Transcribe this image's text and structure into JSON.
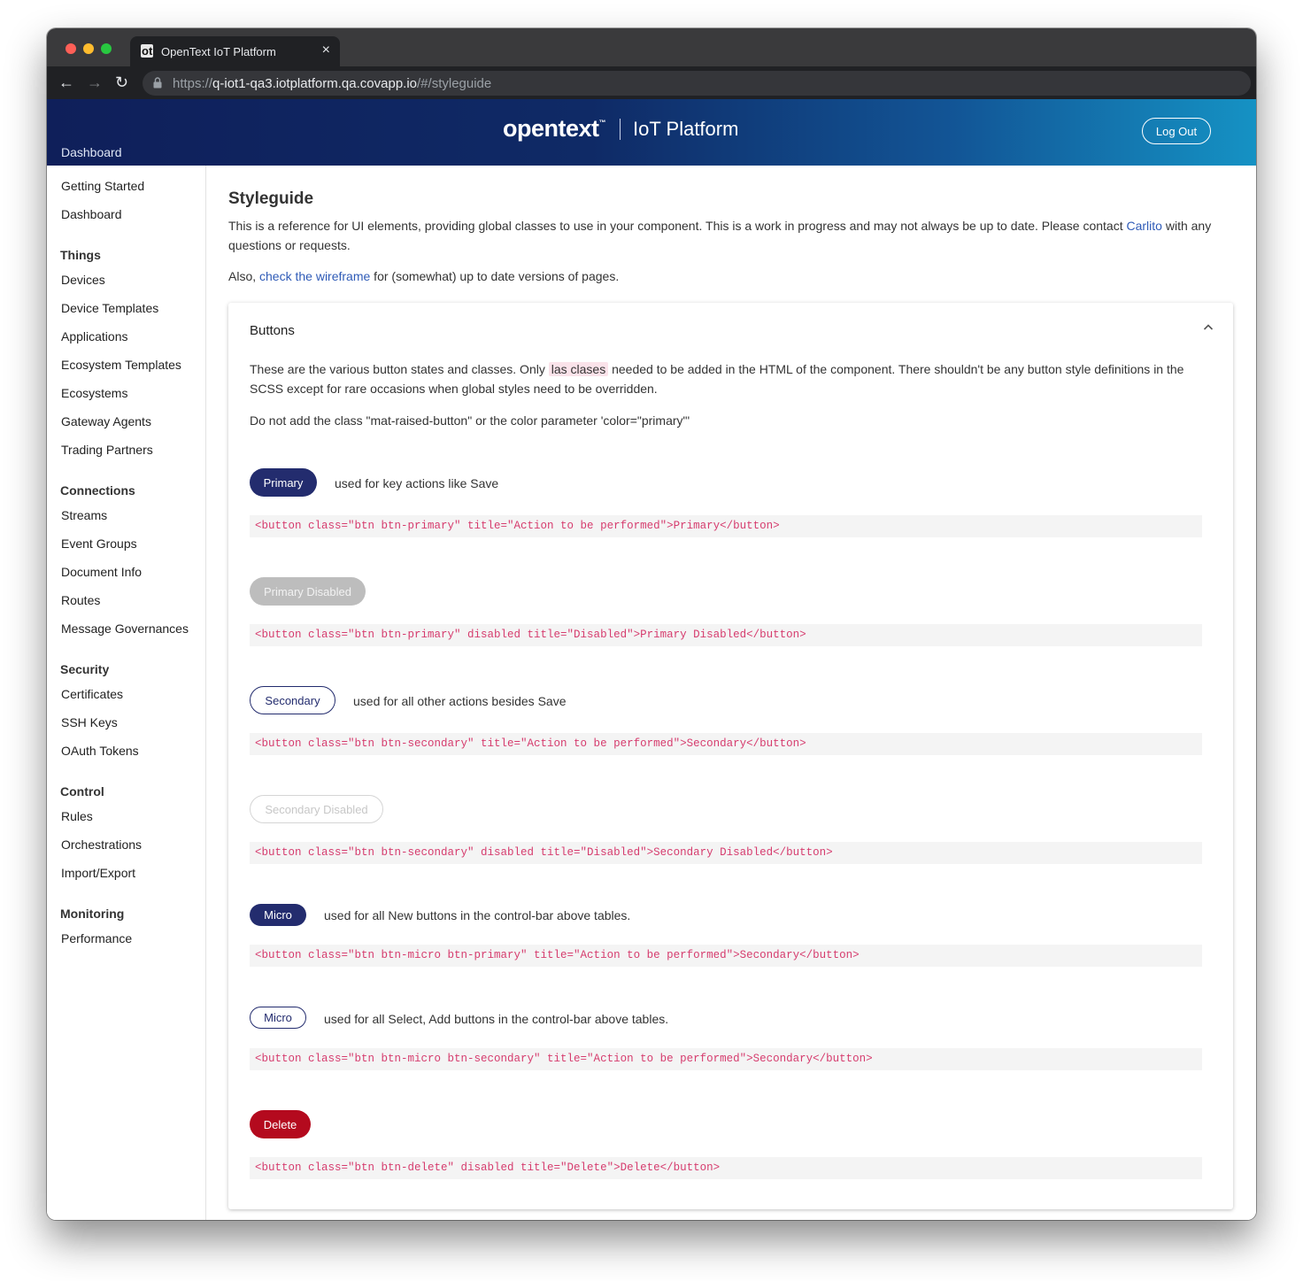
{
  "browser": {
    "tab_title": "OpenText IoT Platform",
    "tab_favicon": "ot",
    "close_icon": "×",
    "back_icon": "←",
    "forward_icon": "→",
    "reload_icon": "↻",
    "url_scheme": "https://",
    "url_host": "q-iot1-qa3.iotplatform.qa.covapp.io",
    "url_path": "/#/styleguide"
  },
  "header": {
    "breadcrumb": "Dashboard",
    "brand_logo": "opentext",
    "brand_tm": "™",
    "product_name": "IoT Platform",
    "logout_label": "Log Out",
    "gradient_colors": [
      "#0f1f5a",
      "#1592c4"
    ]
  },
  "sidebar": {
    "top_items": [
      "Getting Started",
      "Dashboard"
    ],
    "sections": [
      {
        "title": "Things",
        "items": [
          "Devices",
          "Device Templates",
          "Applications",
          "Ecosystem Templates",
          "Ecosystems",
          "Gateway Agents",
          "Trading Partners"
        ]
      },
      {
        "title": "Connections",
        "items": [
          "Streams",
          "Event Groups",
          "Document Info",
          "Routes",
          "Message Governances"
        ]
      },
      {
        "title": "Security",
        "items": [
          "Certificates",
          "SSH Keys",
          "OAuth Tokens"
        ]
      },
      {
        "title": "Control",
        "items": [
          "Rules",
          "Orchestrations",
          "Import/Export"
        ]
      },
      {
        "title": "Monitoring",
        "items": [
          "Performance"
        ]
      }
    ]
  },
  "main": {
    "title": "Styleguide",
    "intro_before": "This is a reference for UI elements, providing global classes to use in your component. This is a work in progress and may not always be up to date. Please contact ",
    "intro_link": "Carlito",
    "intro_after": " with any questions or requests.",
    "also_before": "Also, ",
    "also_link": "check the wireframe",
    "also_after": " for (somewhat) up to date versions of pages."
  },
  "panel": {
    "title": "Buttons",
    "desc_before": "These are the various button states and classes. Only ",
    "desc_highlight": "las clases",
    "desc_after": " needed to be added in the HTML of the component. There shouldn't be any button style definitions in the SCSS except for rare occasions when global styles need to be overridden.",
    "note": "Do not add the class \"mat-raised-button\" or the color parameter 'color=\"primary\"'",
    "examples": [
      {
        "label": "Primary",
        "desc": "used for key actions like Save",
        "code": "<button class=\"btn btn-primary\" title=\"Action to be performed\">Primary</button>"
      },
      {
        "label": "Primary Disabled",
        "desc": "",
        "code": "<button class=\"btn btn-primary\" disabled title=\"Disabled\">Primary Disabled</button>"
      },
      {
        "label": "Secondary",
        "desc": "used for all other actions besides Save",
        "code": "<button class=\"btn btn-secondary\" title=\"Action to be performed\">Secondary</button>"
      },
      {
        "label": "Secondary Disabled",
        "desc": "",
        "code": "<button class=\"btn btn-secondary\" disabled title=\"Disabled\">Secondary Disabled</button>"
      },
      {
        "label": "Micro",
        "desc": "used for all New buttons in the control-bar above tables.",
        "code": "<button class=\"btn btn-micro btn-primary\" title=\"Action to be performed\">Secondary</button>"
      },
      {
        "label": "Micro",
        "desc": "used for all Select, Add buttons in the control-bar above tables.",
        "code": "<button class=\"btn btn-micro btn-secondary\" title=\"Action to be performed\">Secondary</button>"
      },
      {
        "label": "Delete",
        "desc": "",
        "code": "<button class=\"btn btn-delete\" disabled title=\"Delete\">Delete</button>"
      }
    ]
  },
  "colors": {
    "primary": "#232c6e",
    "delete": "#b40a1e",
    "code_text": "#d63c6e",
    "link": "#2f5bb7"
  },
  "icons": {
    "lock": "lock-icon",
    "chevron": "chevron-up-icon"
  }
}
